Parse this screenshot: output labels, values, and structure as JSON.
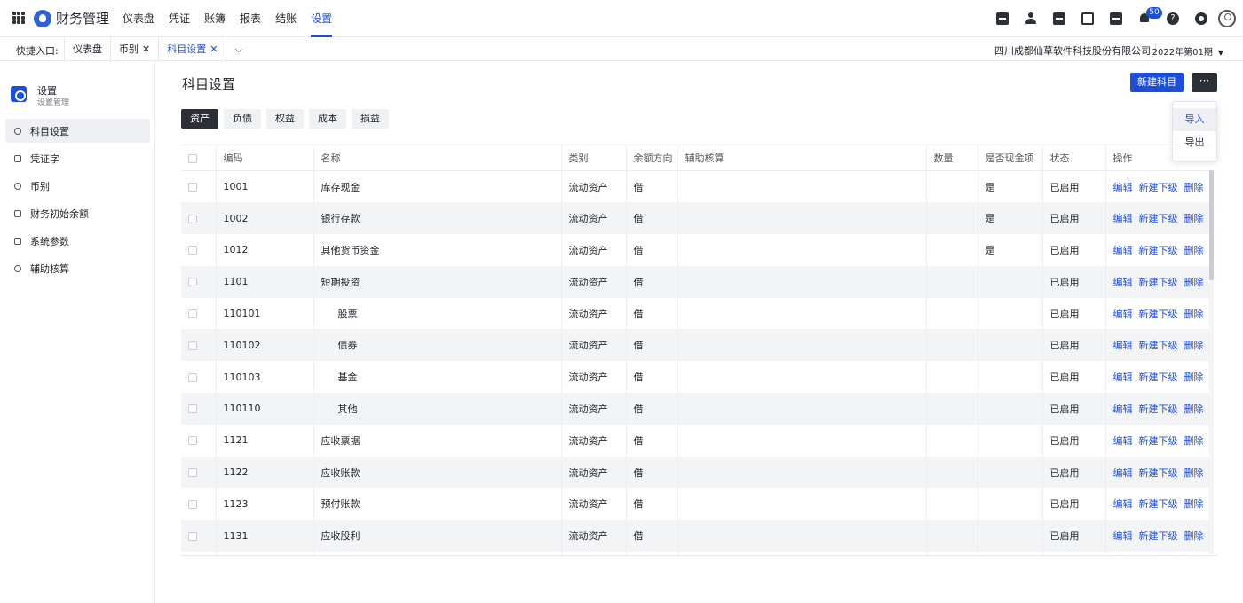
{
  "app": {
    "title": "财务管理",
    "nav": [
      "仪表盘",
      "凭证",
      "账簿",
      "报表",
      "结账",
      "设置"
    ],
    "active_nav": "设置",
    "notifications_count": "50",
    "help_glyph": "?"
  },
  "quickbar": {
    "label": "快捷入口:",
    "tabs": [
      "仪表盘",
      "币别",
      "科目设置"
    ],
    "close_glyph": "✕",
    "chevron_glyph": "⌵",
    "company": "四川成都仙草软件科技股份有限公司",
    "period": "2022年第01期"
  },
  "sidebar": {
    "title": "设置",
    "subtitle": "设置管理",
    "items": [
      "科目设置",
      "凭证字",
      "币别",
      "财务初始余额",
      "系统参数",
      "辅助核算"
    ]
  },
  "main": {
    "title": "科目设置",
    "new_button": "新建科目",
    "more_button": "···",
    "menu": [
      "导入",
      "导出"
    ],
    "tabs": [
      "资产",
      "负债",
      "权益",
      "成本",
      "损益"
    ],
    "columns": [
      "编码",
      "名称",
      "类别",
      "余额方向",
      "辅助核算",
      "数量",
      "是否现金项",
      "状态",
      "操作"
    ],
    "actions": [
      "编辑",
      "新建下级",
      "删除"
    ],
    "rows": [
      {
        "code": "1001",
        "name": "库存现金",
        "category": "流动资产",
        "direction": "借",
        "aux": "",
        "qty": "",
        "cash": "是",
        "status": "已启用"
      },
      {
        "code": "1002",
        "name": "银行存款",
        "category": "流动资产",
        "direction": "借",
        "aux": "",
        "qty": "",
        "cash": "是",
        "status": "已启用"
      },
      {
        "code": "1012",
        "name": "其他货币资金",
        "category": "流动资产",
        "direction": "借",
        "aux": "",
        "qty": "",
        "cash": "是",
        "status": "已启用"
      },
      {
        "code": "1101",
        "name": "短期投资",
        "category": "流动资产",
        "direction": "借",
        "aux": "",
        "qty": "",
        "cash": "",
        "status": "已启用"
      },
      {
        "code": "110101",
        "name": "股票",
        "category": "流动资产",
        "direction": "借",
        "aux": "",
        "qty": "",
        "cash": "",
        "status": "已启用"
      },
      {
        "code": "110102",
        "name": "债券",
        "category": "流动资产",
        "direction": "借",
        "aux": "",
        "qty": "",
        "cash": "",
        "status": "已启用"
      },
      {
        "code": "110103",
        "name": "基金",
        "category": "流动资产",
        "direction": "借",
        "aux": "",
        "qty": "",
        "cash": "",
        "status": "已启用"
      },
      {
        "code": "110110",
        "name": "其他",
        "category": "流动资产",
        "direction": "借",
        "aux": "",
        "qty": "",
        "cash": "",
        "status": "已启用"
      },
      {
        "code": "1121",
        "name": "应收票据",
        "category": "流动资产",
        "direction": "借",
        "aux": "",
        "qty": "",
        "cash": "",
        "status": "已启用"
      },
      {
        "code": "1122",
        "name": "应收账款",
        "category": "流动资产",
        "direction": "借",
        "aux": "",
        "qty": "",
        "cash": "",
        "status": "已启用"
      },
      {
        "code": "1123",
        "name": "预付账款",
        "category": "流动资产",
        "direction": "借",
        "aux": "",
        "qty": "",
        "cash": "",
        "status": "已启用"
      },
      {
        "code": "1131",
        "name": "应收股利",
        "category": "流动资产",
        "direction": "借",
        "aux": "",
        "qty": "",
        "cash": "",
        "status": "已启用"
      },
      {
        "code": "",
        "name": "",
        "category": "",
        "direction": "",
        "aux": "",
        "qty": "",
        "cash": "",
        "status": ""
      }
    ]
  },
  "colors": {
    "accent": "#1d4ed8",
    "dark": "#2b2f36",
    "row_alt": "#f3f4f6"
  }
}
